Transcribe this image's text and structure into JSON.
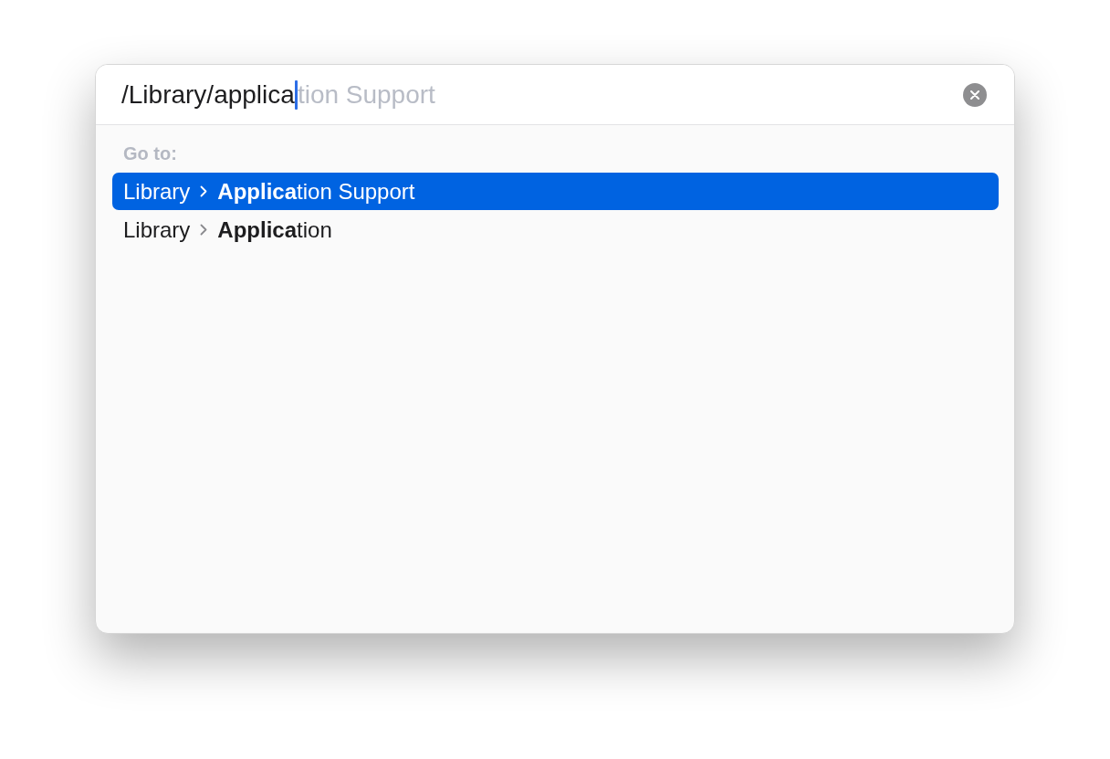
{
  "search": {
    "value": "/Library/applica",
    "completion": "tion Support"
  },
  "section_label": "Go to:",
  "results": [
    {
      "parent": "Library",
      "name": "**Applica**tion Support",
      "selected": true
    },
    {
      "parent": "Library",
      "name": "**Applica**tion",
      "selected": false
    }
  ]
}
